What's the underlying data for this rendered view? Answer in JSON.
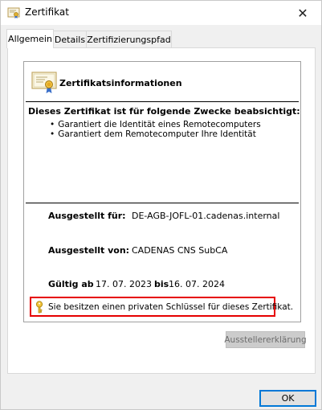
{
  "window": {
    "title": "Zertifikat",
    "close_label": "✕"
  },
  "tabs": [
    {
      "label": "Allgemein",
      "active": true
    },
    {
      "label": "Details",
      "active": false
    },
    {
      "label": "Zertifizierungspfad",
      "active": false
    }
  ],
  "certificate": {
    "info_title": "Zertifikatsinformationen",
    "purpose_heading": "Dieses Zertifikat ist für folgende Zwecke beabsichtigt:",
    "purposes": [
      "Garantiert die Identität eines Remotecomputers",
      "Garantiert dem Remotecomputer Ihre Identität"
    ],
    "issued_to_label": "Ausgestellt für:",
    "issued_to_value": "DE-AGB-JOFL-01.cadenas.internal",
    "issued_by_label": "Ausgestellt von:",
    "issued_by_value": "CADENAS CNS SubCA",
    "valid_from_label": "Gültig ab",
    "valid_from_value": "17. 07. 2023",
    "valid_to_label": "bis",
    "valid_to_value": "16. 07. 2024",
    "private_key_note": "Sie besitzen einen privaten Schlüssel für dieses Zertifikat."
  },
  "buttons": {
    "issuer_statement": "Ausstellererklärung",
    "ok": "OK"
  },
  "icons": {
    "title_icon": "certificate-icon",
    "cert_icon": "certificate-ribbon-icon",
    "key_icon": "key-icon"
  },
  "colors": {
    "highlight_border": "#e60000",
    "ok_border": "#0078d7"
  }
}
